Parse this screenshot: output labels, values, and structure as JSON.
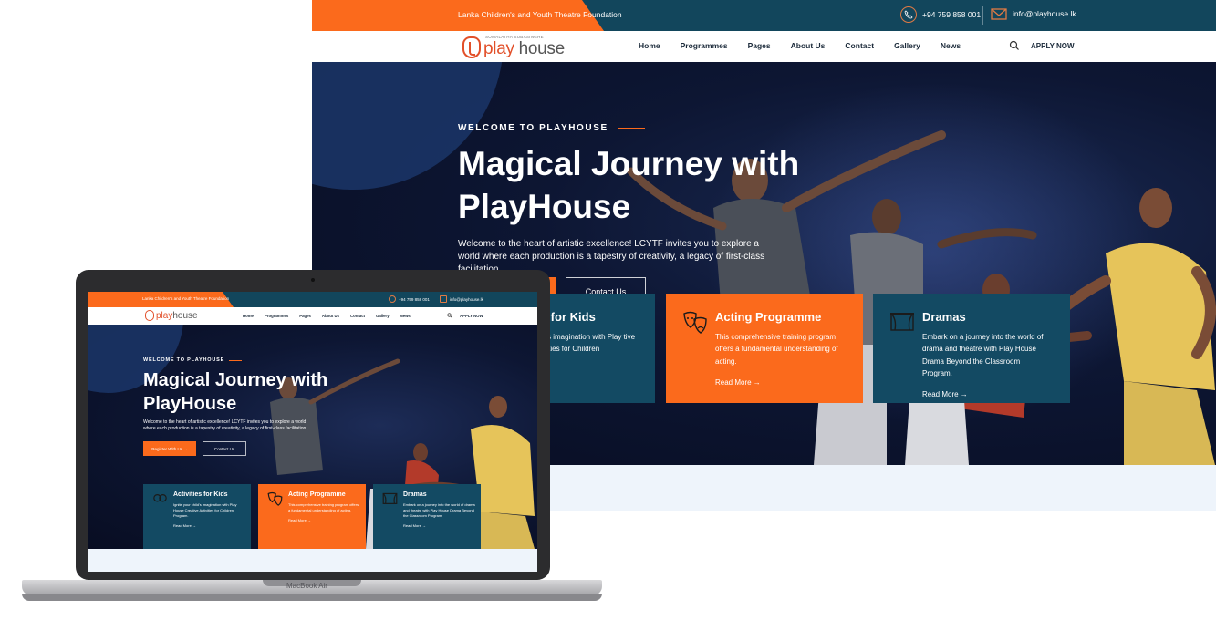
{
  "site": {
    "org_name": "Lanka Children's and Youth Theatre Foundation",
    "phone": "+94 759 858 001",
    "email": "info@playhouse.lk",
    "logo": {
      "sub": "SOMALATHA SUBASINGHE",
      "brand_1": "play",
      "brand_2": " house"
    },
    "nav": [
      "Home",
      "Programmes",
      "Pages",
      "About Us",
      "Contact",
      "Gallery",
      "News"
    ],
    "apply_label": "APPLY NOW",
    "hero": {
      "eyebrow": "WELCOME TO PLAYHOUSE",
      "title": "Magical Journey with PlayHouse",
      "text": "Welcome to the heart of artistic excellence! LCYTF invites you to explore a world where each production is a tapestry of creativity, a legacy of first-class facilitation.",
      "btn_register": "Register With Us",
      "btn_contact": "Contact Us"
    },
    "cards": [
      {
        "title": "Activities for Kids",
        "text": "Ignite your child's imagination with Play House Creative Activities for Children Program.",
        "more": "Read More"
      },
      {
        "title": "Acting Programme",
        "text": "This comprehensive training program offers a fundamental understanding of acting.",
        "more": "Read More"
      },
      {
        "title": "Dramas",
        "text": "Embark on a journey into the world of drama and theatre with Play House Drama Beyond the Classroom Program.",
        "more": "Read More"
      }
    ],
    "large_view": {
      "card_0_title_fragment": "ies for Kids",
      "card_0_text_fragment": "child's imagination with Play tive Activities for Children"
    }
  },
  "device": {
    "label": "MacBook Air"
  },
  "colors": {
    "orange": "#fb6a1c",
    "teal": "#12465c",
    "navy": "#0d1633"
  }
}
